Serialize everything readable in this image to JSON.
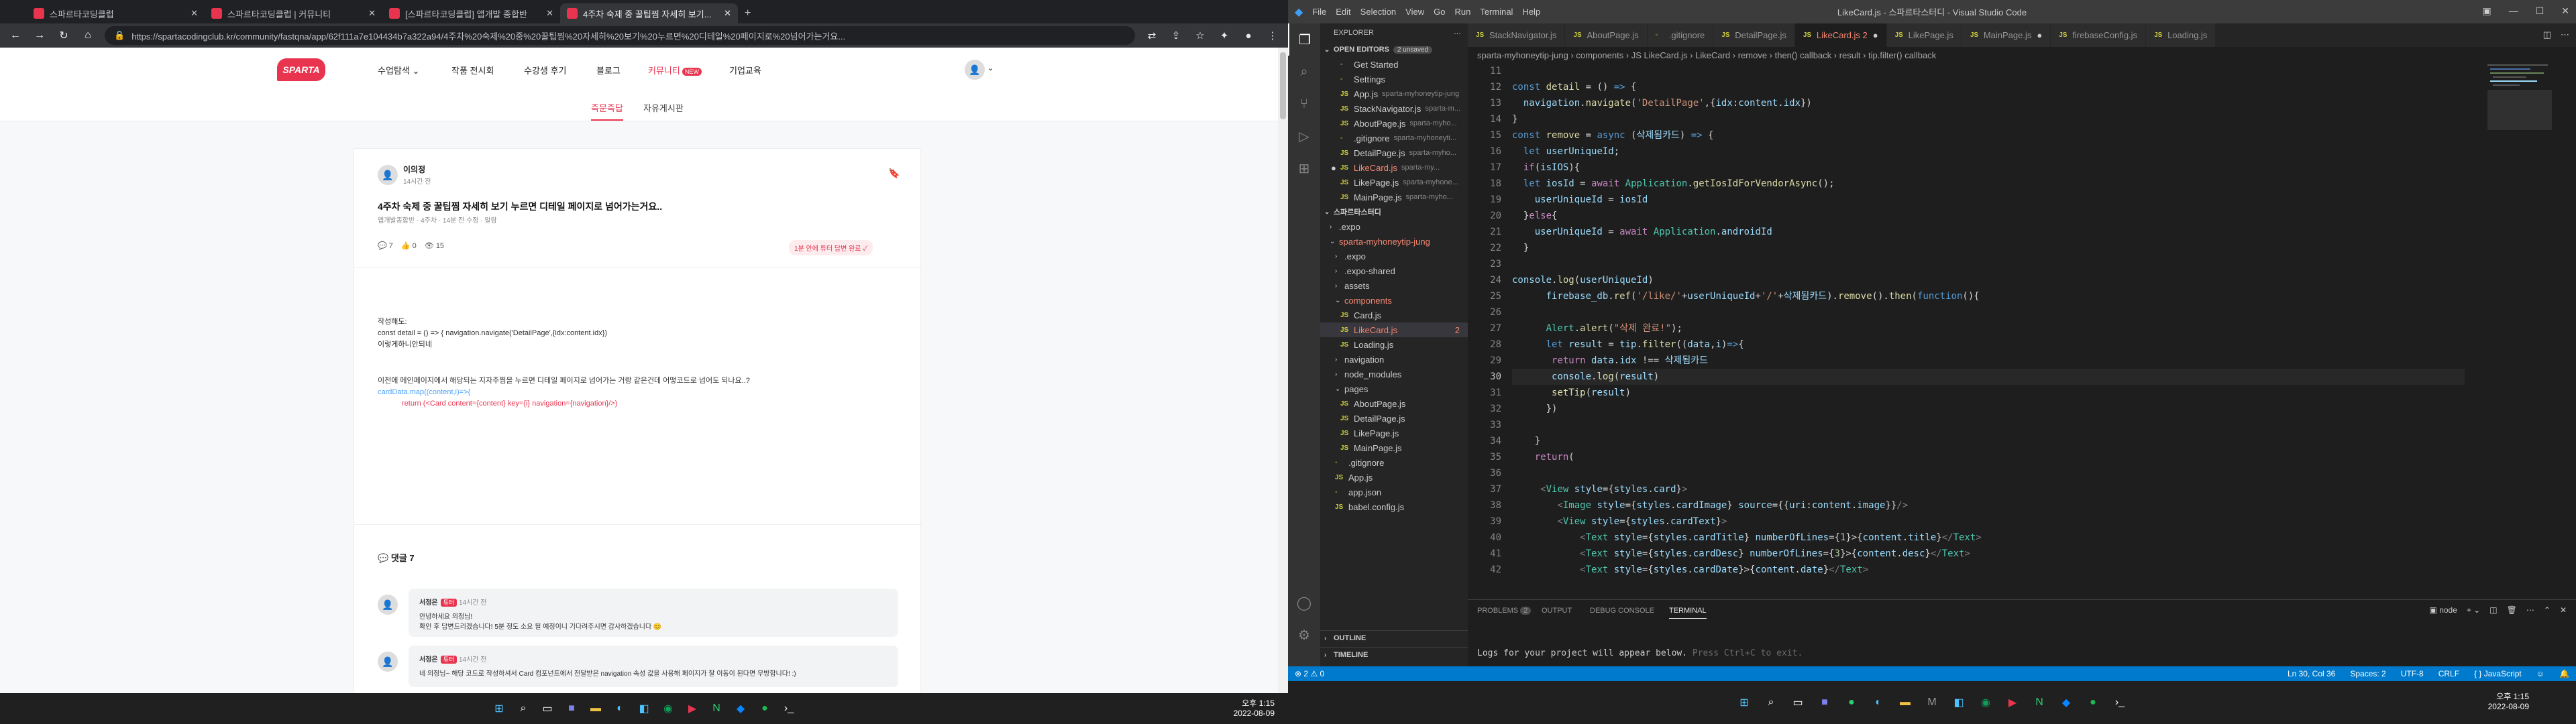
{
  "browser": {
    "tabs": [
      {
        "label": "스파르타코딩클럽"
      },
      {
        "label": "스파르타코딩클럽 | 커뮤니티"
      },
      {
        "label": "[스파르타코딩클럽] 앱개발 종합반"
      },
      {
        "label": "4주차 숙제 중 꿀팁찜 자세히 보기..."
      }
    ],
    "url": "https://spartacodingclub.kr/community/fastqna/app/62f111a7e104434b7a322a94/4주차%20숙제%20중%20꿀팁찜%20자세히%20보기%20누르면%20디테일%20페이지로%20넘어가는거요..."
  },
  "site": {
    "logo": "SPARTA",
    "nav": [
      "수업탐색 ⌄",
      "작품 전시회",
      "수강생 후기",
      "블로그",
      "커뮤니티",
      "기업교육"
    ],
    "new_badge": "NEW",
    "subtabs": [
      "즉문즉답",
      "자유게시판"
    ],
    "post": {
      "author": "이의정",
      "time": "14시간 전",
      "title": "4주차 숙제 중 꿀팁찜 자세히 보기 누르면 디테일 페이지로 넘어가는거요..",
      "meta": "앱개발종합반 · 4주차 · 14분 전 수정 · 알람",
      "comments": "7",
      "likes": "0",
      "views": "15",
      "answered": "1분 안에 튜터 답변 완료 ✓",
      "body_lines": [
        "작성해도:",
        "const detail = () => { navigation.navigate('DetailPage',{idx:content.idx})",
        "이렇게하니안되네"
      ],
      "body2": "이전에 메인페이지에서 해당되는 지자주찜을 누르면 디테일 페이지로 넘어가는 거랑 같은건데 어떻코드로 넘어도 되나요..?",
      "code1": "cardData.map((content,i)=>{",
      "code2": "return (<Card content={content} key={i} navigation={navigation}/>)"
    },
    "comments_title": "댓글 7",
    "comments": [
      {
        "author": "서정은",
        "badge": "튜터",
        "time": "14시간 전",
        "text": "안녕하세요 의정님!",
        "text2": "확인 후 답변드리겠습니다! 5분 정도 소요 될 예정이니 기다려주시면 감사하겠습니다 😊"
      },
      {
        "author": "서정은",
        "badge": "튜터",
        "time": "14시간 전",
        "text": "네 의정님~ 해당 코드로 작성하셔서 Card 컴포넌트에서 전달받은 navigation 속성 값을 사용해 페이지가 잘 이동이 된다면 무방합니다! :)",
        "text2": ""
      }
    ]
  },
  "vscode": {
    "menu": [
      "File",
      "Edit",
      "Selection",
      "View",
      "Go",
      "Run",
      "Terminal",
      "Help"
    ],
    "window_title": "LikeCard.js - 스파르타스터디 - Visual Studio Code",
    "explorer_title": "EXPLORER",
    "open_editors_label": "OPEN EDITORS",
    "unsaved": "2 unsaved",
    "open_editors": [
      {
        "name": "Get Started",
        "path": "",
        "state": ""
      },
      {
        "name": "Settings",
        "path": "",
        "state": ""
      },
      {
        "name": "App.js",
        "path": "sparta-myhoneytip-jung",
        "state": ""
      },
      {
        "name": "StackNavigator.js",
        "path": "sparta-m...",
        "state": ""
      },
      {
        "name": "AboutPage.js",
        "path": "sparta-myho...",
        "state": ""
      },
      {
        "name": ".gitignore",
        "path": "sparta-myhoneyti...",
        "state": ""
      },
      {
        "name": "DetailPage.js",
        "path": "sparta-myho...",
        "state": ""
      },
      {
        "name": "LikeCard.js",
        "path": "sparta-my...",
        "state": "err"
      },
      {
        "name": "LikePage.js",
        "path": "sparta-myhone...",
        "state": ""
      },
      {
        "name": "MainPage.js",
        "path": "sparta-myho...",
        "state": ""
      }
    ],
    "workspace": "스파르타스터디",
    "tree": [
      {
        "name": ".expo",
        "depth": 1,
        "type": "folder"
      },
      {
        "name": "sparta-myhoneytip-jung",
        "depth": 1,
        "type": "folder-open",
        "state": "err"
      },
      {
        "name": ".expo",
        "depth": 2,
        "type": "folder"
      },
      {
        "name": ".expo-shared",
        "depth": 2,
        "type": "folder"
      },
      {
        "name": "assets",
        "depth": 2,
        "type": "folder"
      },
      {
        "name": "components",
        "depth": 2,
        "type": "folder-open",
        "state": "err"
      },
      {
        "name": "Card.js",
        "depth": 3,
        "type": "js"
      },
      {
        "name": "LikeCard.js",
        "depth": 3,
        "type": "js",
        "state": "err",
        "count": "2"
      },
      {
        "name": "Loading.js",
        "depth": 3,
        "type": "js"
      },
      {
        "name": "navigation",
        "depth": 2,
        "type": "folder"
      },
      {
        "name": "node_modules",
        "depth": 2,
        "type": "folder"
      },
      {
        "name": "pages",
        "depth": 2,
        "type": "folder-open"
      },
      {
        "name": "AboutPage.js",
        "depth": 3,
        "type": "js"
      },
      {
        "name": "DetailPage.js",
        "depth": 3,
        "type": "js"
      },
      {
        "name": "LikePage.js",
        "depth": 3,
        "type": "js"
      },
      {
        "name": "MainPage.js",
        "depth": 3,
        "type": "js"
      },
      {
        "name": ".gitignore",
        "depth": 2,
        "type": "file"
      },
      {
        "name": "App.js",
        "depth": 2,
        "type": "js"
      },
      {
        "name": "app.json",
        "depth": 2,
        "type": "file"
      },
      {
        "name": "babel.config.js",
        "depth": 2,
        "type": "js"
      }
    ],
    "outline": "OUTLINE",
    "timeline": "TIMELINE",
    "editor_tabs": [
      "StackNavigator.js",
      "AboutPage.js",
      ".gitignore",
      "DetailPage.js",
      "LikeCard.js 2",
      "LikePage.js",
      "MainPage.js",
      "firebaseConfig.js",
      "Loading.js"
    ],
    "breadcrumb": "sparta-myhoneytip-jung  ›  components  ›  JS LikeCard.js  ›  LikeCard  ›  remove  ›  then() callback  ›  result  ›  tip.filter() callback",
    "code_lines": [
      {
        "n": "11",
        "html": ""
      },
      {
        "n": "12",
        "html": "<span style='color:#569cd6'>const</span> <span style='color:#dcdcaa'>detail</span> = () <span style='color:#569cd6'>=&gt;</span> {"
      },
      {
        "n": "13",
        "html": "  <span style='color:#9cdcfe'>navigation</span>.<span style='color:#dcdcaa'>navigate</span>(<span style='color:#ce9178'>'DetailPage'</span>,{<span style='color:#9cdcfe'>idx</span>:<span style='color:#9cdcfe'>content</span>.<span style='color:#9cdcfe'>idx</span>})"
      },
      {
        "n": "14",
        "html": "}"
      },
      {
        "n": "15",
        "html": "<span style='color:#569cd6'>const</span> <span style='color:#dcdcaa'>remove</span> = <span style='color:#569cd6'>async</span> (<span style='color:#9cdcfe'>삭제됨카드</span>) <span style='color:#569cd6'>=&gt;</span> {"
      },
      {
        "n": "16",
        "html": "  <span style='color:#569cd6'>let</span> <span style='color:#9cdcfe'>userUniqueId</span>;"
      },
      {
        "n": "17",
        "html": "  <span style='color:#c586c0'>if</span>(<span style='color:#9cdcfe'>isIOS</span>){"
      },
      {
        "n": "18",
        "html": "  <span style='color:#569cd6'>let</span> <span style='color:#9cdcfe'>iosId</span> = <span style='color:#c586c0'>await</span> <span style='color:#4ec9b0'>Application</span>.<span style='color:#dcdcaa'>getIosIdForVendorAsync</span>();"
      },
      {
        "n": "19",
        "html": "    <span style='color:#9cdcfe'>userUniqueId</span> = <span style='color:#9cdcfe'>iosId</span>"
      },
      {
        "n": "20",
        "html": "  }<span style='color:#c586c0'>else</span>{"
      },
      {
        "n": "21",
        "html": "    <span style='color:#9cdcfe'>userUniqueId</span> = <span style='color:#c586c0'>await</span> <span style='color:#4ec9b0'>Application</span>.<span style='color:#9cdcfe'>androidId</span>"
      },
      {
        "n": "22",
        "html": "  }"
      },
      {
        "n": "23",
        "html": ""
      },
      {
        "n": "24",
        "html": "<span style='color:#9cdcfe'>console</span>.<span style='color:#dcdcaa'>log</span>(<span style='color:#9cdcfe'>userUniqueId</span>)"
      },
      {
        "n": "25",
        "html": "      <span style='color:#9cdcfe'>firebase_db</span>.<span style='color:#dcdcaa'>ref</span>(<span style='color:#ce9178'>'/like/'</span>+<span style='color:#9cdcfe'>userUniqueId</span>+<span style='color:#ce9178'>'/'</span>+<span style='color:#9cdcfe'>삭제됨카드</span>).<span style='color:#dcdcaa'>remove</span>().<span style='color:#dcdcaa'>then</span>(<span style='color:#569cd6'>function</span>(){"
      },
      {
        "n": "26",
        "html": ""
      },
      {
        "n": "27",
        "html": "      <span style='color:#4ec9b0'>Alert</span>.<span style='color:#dcdcaa'>alert</span>(<span style='color:#ce9178'>\"삭제 완료!\"</span>);"
      },
      {
        "n": "28",
        "html": "      <span style='color:#569cd6'>let</span> <span style='color:#9cdcfe'>result</span> = <span style='color:#9cdcfe'>tip</span>.<span style='color:#dcdcaa'>filter</span>((<span style='color:#9cdcfe'>data</span>,<span style='color:#9cdcfe'>i</span>)<span style='color:#569cd6'>=&gt;</span>{"
      },
      {
        "n": "29",
        "html": "       <span style='color:#c586c0'>return</span> <span style='color:#9cdcfe'>data</span>.<span style='color:#9cdcfe'>idx</span> !== <span style='color:#9cdcfe'>삭제됨카드</span>"
      },
      {
        "n": "30",
        "html": "       <span style='color:#9cdcfe'>console</span>.<span style='color:#dcdcaa'>log</span>(<span style='color:#9cdcfe'>result</span>)"
      },
      {
        "n": "31",
        "html": "       <span style='color:#dcdcaa'>setTip</span>(<span style='color:#9cdcfe'>result</span>)"
      },
      {
        "n": "32",
        "html": "      })"
      },
      {
        "n": "33",
        "html": ""
      },
      {
        "n": "34",
        "html": "    }"
      },
      {
        "n": "35",
        "html": "    <span style='color:#c586c0'>return</span>("
      },
      {
        "n": "36",
        "html": ""
      },
      {
        "n": "37",
        "html": "     <span style='color:#808080'>&lt;</span><span style='color:#4ec9b0'>View</span> <span style='color:#9cdcfe'>style</span>={<span style='color:#9cdcfe'>styles</span>.<span style='color:#9cdcfe'>card</span>}<span style='color:#808080'>&gt;</span>"
      },
      {
        "n": "38",
        "html": "        <span style='color:#808080'>&lt;</span><span style='color:#4ec9b0'>Image</span> <span style='color:#9cdcfe'>style</span>={<span style='color:#9cdcfe'>styles</span>.<span style='color:#9cdcfe'>cardImage</span>} <span style='color:#9cdcfe'>source</span>={{<span style='color:#9cdcfe'>uri</span>:<span style='color:#9cdcfe'>content</span>.<span style='color:#9cdcfe'>image</span>}}<span style='color:#808080'>/&gt;</span>"
      },
      {
        "n": "39",
        "html": "        <span style='color:#808080'>&lt;</span><span style='color:#4ec9b0'>View</span> <span style='color:#9cdcfe'>style</span>={<span style='color:#9cdcfe'>styles</span>.<span style='color:#9cdcfe'>cardText</span>}<span style='color:#808080'>&gt;</span>"
      },
      {
        "n": "40",
        "html": "            <span style='color:#808080'>&lt;</span><span style='color:#4ec9b0'>Text</span> <span style='color:#9cdcfe'>style</span>={<span style='color:#9cdcfe'>styles</span>.<span style='color:#9cdcfe'>cardTitle</span>} <span style='color:#9cdcfe'>numberOfLines</span>={<span style='color:#b5cea8'>1</span>}&gt;{<span style='color:#9cdcfe'>content</span>.<span style='color:#9cdcfe'>title</span>}<span style='color:#808080'>&lt;/</span><span style='color:#4ec9b0'>Text</span><span style='color:#808080'>&gt;</span>"
      },
      {
        "n": "41",
        "html": "            <span style='color:#808080'>&lt;</span><span style='color:#4ec9b0'>Text</span> <span style='color:#9cdcfe'>style</span>={<span style='color:#9cdcfe'>styles</span>.<span style='color:#9cdcfe'>cardDesc</span>} <span style='color:#9cdcfe'>numberOfLines</span>={<span style='color:#b5cea8'>3</span>}&gt;{<span style='color:#9cdcfe'>content</span>.<span style='color:#9cdcfe'>desc</span>}<span style='color:#808080'>&lt;/</span><span style='color:#4ec9b0'>Text</span><span style='color:#808080'>&gt;</span>"
      },
      {
        "n": "42",
        "html": "            <span style='color:#808080'>&lt;</span><span style='color:#4ec9b0'>Text</span> <span style='color:#9cdcfe'>style</span>={<span style='color:#9cdcfe'>styles</span>.<span style='color:#9cdcfe'>cardDate</span>}&gt;{<span style='color:#9cdcfe'>content</span>.<span style='color:#9cdcfe'>date</span>}<span style='color:#808080'>&lt;/</span><span style='color:#4ec9b0'>Text</span><span style='color:#808080'>&gt;</span>"
      }
    ],
    "current_line": "30",
    "panel_tabs": [
      "PROBLEMS",
      "OUTPUT",
      "DEBUG CONSOLE",
      "TERMINAL"
    ],
    "problems_count": "2",
    "terminal_text": "Logs for your project will appear below.",
    "terminal_hint": "Press Ctrl+C to exit.",
    "terminal_shell": "node",
    "status_left": "⊗ 2 ⚠ 0",
    "status_right": [
      "Ln 30, Col 36",
      "Spaces: 2",
      "UTF-8",
      "CRLF",
      "{ } JavaScript"
    ]
  },
  "taskbar": {
    "time": "오후 1:15",
    "date": "2022-08-09"
  }
}
